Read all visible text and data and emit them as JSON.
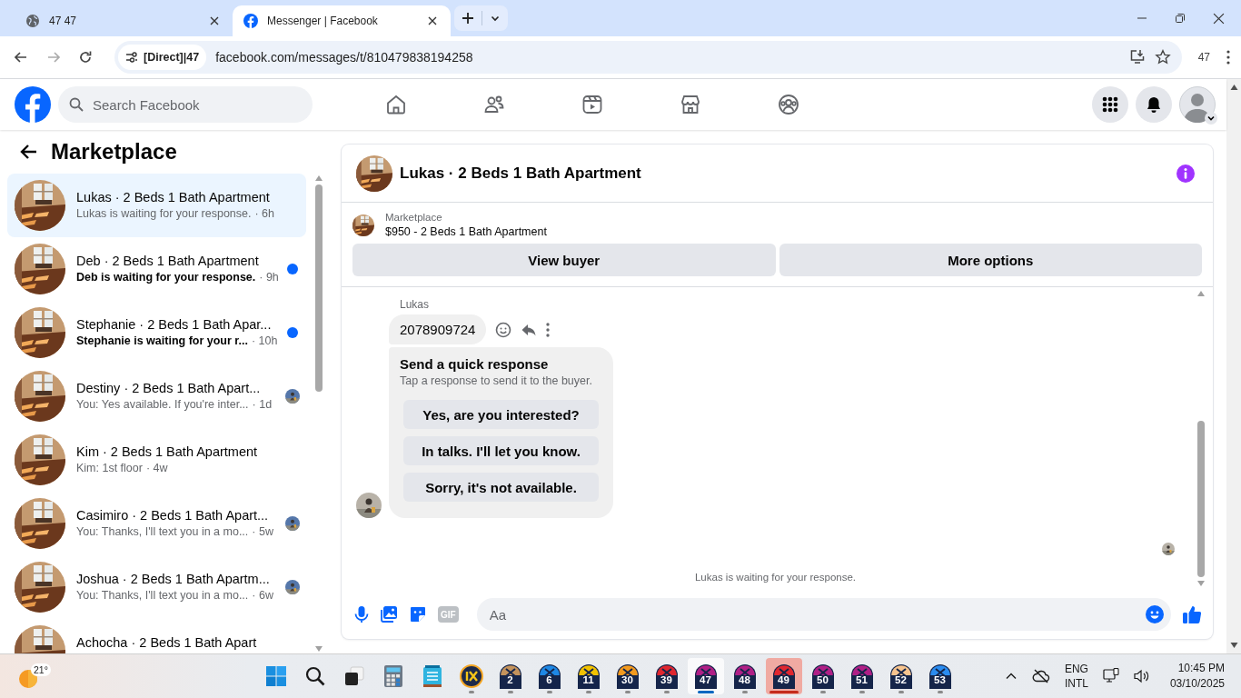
{
  "browser": {
    "tabs": [
      {
        "title": "47 47",
        "selected": false
      },
      {
        "title": "Messenger | Facebook",
        "selected": true
      }
    ],
    "site_chip": "[Direct]|47",
    "url": "facebook.com/messages/t/810479838194258",
    "profile_label": "47"
  },
  "topbar": {
    "search_placeholder": "Search Facebook"
  },
  "sidebar": {
    "title": "Marketplace",
    "conversations": [
      {
        "title": "Lukas · 2 Beds 1 Bath Apartment",
        "preview": "Lukas is waiting for your response.",
        "time": "· 6h",
        "selected": true,
        "unread": false,
        "seen_avatar": false
      },
      {
        "title": "Deb · 2 Beds 1 Bath Apartment",
        "preview": "Deb is waiting for your response.",
        "time": "· 9h",
        "selected": false,
        "unread": true,
        "seen_avatar": false
      },
      {
        "title": "Stephanie · 2 Beds 1 Bath Apar...",
        "preview": "Stephanie is waiting for your r...",
        "time": "· 10h",
        "selected": false,
        "unread": true,
        "seen_avatar": false
      },
      {
        "title": "Destiny · 2 Beds 1 Bath Apart...",
        "preview": "You: Yes available. If you're inter...",
        "time": "· 1d",
        "selected": false,
        "unread": false,
        "seen_avatar": true
      },
      {
        "title": "Kim · 2 Beds 1 Bath Apartment",
        "preview": "Kim: 1st floor",
        "time": "· 4w",
        "selected": false,
        "unread": false,
        "seen_avatar": false
      },
      {
        "title": "Casimiro · 2 Beds 1 Bath Apart...",
        "preview": "You: Thanks, I'll text you in a mo...",
        "time": "· 5w",
        "selected": false,
        "unread": false,
        "seen_avatar": true
      },
      {
        "title": "Joshua · 2 Beds 1 Bath Apartm...",
        "preview": "You: Thanks, I'll text you in a mo...",
        "time": "· 6w",
        "selected": false,
        "unread": false,
        "seen_avatar": true
      },
      {
        "title": "Achocha · 2 Beds 1 Bath Apart",
        "selected": false
      }
    ]
  },
  "chat": {
    "title": "Lukas · 2 Beds 1 Bath Apartment",
    "listing": {
      "label": "Marketplace",
      "text": "$950 - 2 Beds 1 Bath Apartment"
    },
    "buttons": [
      "View buyer",
      "More options"
    ],
    "sender": "Lukas",
    "message": "2078909724",
    "quick_response": {
      "title": "Send a quick response",
      "subtitle": "Tap a response to send it to the buyer.",
      "options": [
        "Yes, are you interested?",
        "In talks. I'll let you know.",
        "Sorry, it's not available."
      ]
    },
    "status": "Lukas is waiting for your response.",
    "gif_label": "GIF",
    "composer_placeholder": "Aa"
  },
  "taskbar": {
    "weather": "21°",
    "apps": [
      {
        "label": "2",
        "color": "#c4935c",
        "selected": false,
        "flashing": false
      },
      {
        "label": "6",
        "color": "#1e88e5",
        "selected": false,
        "flashing": false
      },
      {
        "label": "11",
        "color": "#f2c200",
        "selected": false,
        "flashing": false
      },
      {
        "label": "30",
        "color": "#f39a1e",
        "selected": false,
        "flashing": false
      },
      {
        "label": "39",
        "color": "#e0262f",
        "selected": false,
        "flashing": false
      },
      {
        "label": "47",
        "color": "#b01f86",
        "selected": true,
        "flashing": false
      },
      {
        "label": "48",
        "color": "#b01f86",
        "selected": false,
        "flashing": false
      },
      {
        "label": "49",
        "color": "#e0262f",
        "selected": false,
        "flashing": true
      },
      {
        "label": "50",
        "color": "#b01f86",
        "selected": false,
        "flashing": false
      },
      {
        "label": "51",
        "color": "#b01f86",
        "selected": false,
        "flashing": false
      },
      {
        "label": "52",
        "color": "#f7c48e",
        "selected": false,
        "flashing": false
      },
      {
        "label": "53",
        "color": "#2a8cf0",
        "selected": false,
        "flashing": false
      }
    ],
    "language": [
      "ENG",
      "INTL"
    ],
    "time": "10:45 PM",
    "date": "03/10/2025"
  }
}
